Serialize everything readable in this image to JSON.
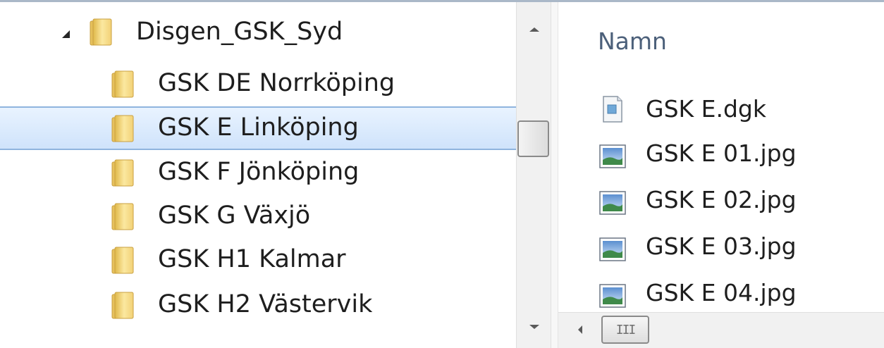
{
  "nav_tree": {
    "root": {
      "label": "Disgen_GSK_Syd",
      "expanded": true,
      "icon": "folder-icon"
    },
    "children": [
      {
        "label": "GSK DE Norrköping",
        "selected": false,
        "icon": "folder-icon"
      },
      {
        "label": "GSK E Linköping",
        "selected": true,
        "icon": "folder-icon"
      },
      {
        "label": "GSK F Jönköping",
        "selected": false,
        "icon": "folder-icon"
      },
      {
        "label": "GSK G Växjö",
        "selected": false,
        "icon": "folder-icon"
      },
      {
        "label": "GSK H1 Kalmar",
        "selected": false,
        "icon": "folder-icon"
      },
      {
        "label": "GSK H2 Västervik",
        "selected": false,
        "icon": "folder-icon"
      }
    ]
  },
  "file_list": {
    "column_header": "Namn",
    "files": [
      {
        "name": "GSK E.dgk",
        "icon": "document-icon"
      },
      {
        "name": "GSK E 01.jpg",
        "icon": "image-icon"
      },
      {
        "name": "GSK E 02.jpg",
        "icon": "image-icon"
      },
      {
        "name": "GSK E 03.jpg",
        "icon": "image-icon"
      },
      {
        "name": "GSK E 04.jpg",
        "icon": "image-icon"
      }
    ]
  },
  "scrollbars": {
    "horizontal_grip": "III"
  },
  "colors": {
    "selection_background": "#cfe3fb",
    "selection_border": "#8fb4de",
    "header_text": "#4c607a",
    "folder_yellow": "#f5d97a"
  }
}
